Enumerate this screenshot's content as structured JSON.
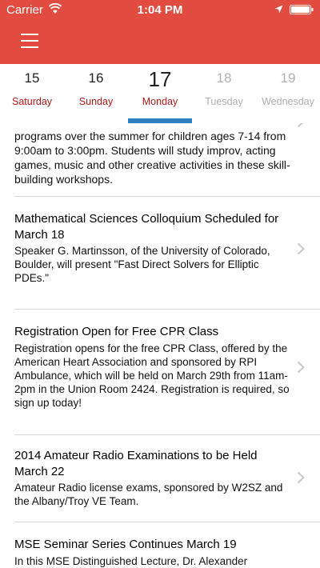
{
  "status_bar": {
    "carrier": "Carrier",
    "time": "1:04 PM",
    "icons": [
      "wifi-icon",
      "location-icon",
      "battery-icon"
    ]
  },
  "header": {
    "menu_icon": "hamburger-menu-icon",
    "color": "#e24b40"
  },
  "days": [
    {
      "num": "15",
      "name": "Saturday"
    },
    {
      "num": "16",
      "name": "Sunday"
    },
    {
      "num": "17",
      "name": "Monday"
    },
    {
      "num": "18",
      "name": "Tuesday"
    },
    {
      "num": "19",
      "name": "Wednesday"
    }
  ],
  "selected_day_index": 2,
  "colors": {
    "accent_red": "#e24b40",
    "day_name_red": "#b01818",
    "indicator_blue": "#2f7fc1",
    "inactive_gray": "#b0b0b0"
  },
  "items": [
    {
      "title": "",
      "body": "programs over the summer for children ages 7-14 from 9:00am to 3:00pm. Students will study improv, acting games, music and other creative activities in these skill-building workshops."
    },
    {
      "title": "Mathematical Sciences Colloquium Scheduled for March 18",
      "body": "Speaker G. Martinsson, of the University of Colorado, Boulder, will present \"Fast Direct Solvers for Elliptic PDEs.\""
    },
    {
      "title": "Registration Open for Free CPR Class",
      "body": "Registration opens for the free CPR Class, offered by the American Heart Association and sponsored by RPI Ambulance, which will be held on March 29th from 11am-2pm in the Union Room 2424. Registration is required, so sign up today!"
    },
    {
      "title": "2014 Amateur Radio Examinations to be Held March 22",
      "body": "Amateur Radio license exams, sponsored by W2SZ and the Albany/Troy VE Team."
    },
    {
      "title": "MSE Seminar Series Continues March 19",
      "body": "In this MSE Distinguished Lecture, Dr. Alexander"
    }
  ]
}
